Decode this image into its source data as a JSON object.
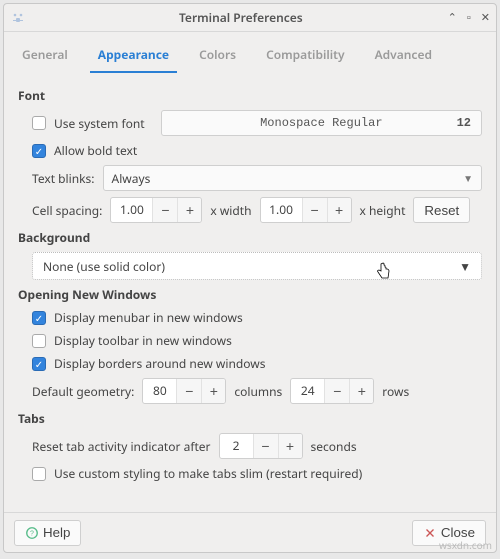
{
  "window": {
    "title": "Terminal Preferences"
  },
  "tabs": [
    "General",
    "Appearance",
    "Colors",
    "Compatibility",
    "Advanced"
  ],
  "active_tab": 1,
  "font": {
    "section": "Font",
    "use_system_label": "Use system font",
    "use_system_checked": false,
    "font_name": "Monospace Regular",
    "font_size": "12",
    "allow_bold_label": "Allow bold text",
    "allow_bold_checked": true,
    "text_blinks_label": "Text blinks:",
    "text_blinks_value": "Always",
    "cell_spacing_label": "Cell spacing:",
    "cell_width": "1.00",
    "x_width_label": "x width",
    "cell_height": "1.00",
    "x_height_label": "x height",
    "reset_label": "Reset"
  },
  "background": {
    "section": "Background",
    "value": "None (use solid color)"
  },
  "opening": {
    "section": "Opening New Windows",
    "menubar_label": "Display menubar in new windows",
    "menubar_checked": true,
    "toolbar_label": "Display toolbar in new windows",
    "toolbar_checked": false,
    "borders_label": "Display borders around new windows",
    "borders_checked": true,
    "geometry_label": "Default geometry:",
    "columns": "80",
    "columns_label": "columns",
    "rows_value": "24",
    "rows_label": "rows"
  },
  "tabs_section": {
    "section": "Tabs",
    "reset_label": "Reset tab activity indicator after",
    "reset_value": "2",
    "seconds_label": "seconds",
    "custom_styling_label": "Use custom styling to make tabs slim (restart required)",
    "custom_styling_checked": false
  },
  "footer": {
    "help_label": "Help",
    "close_label": "Close"
  },
  "watermark": "wsxdn.com"
}
